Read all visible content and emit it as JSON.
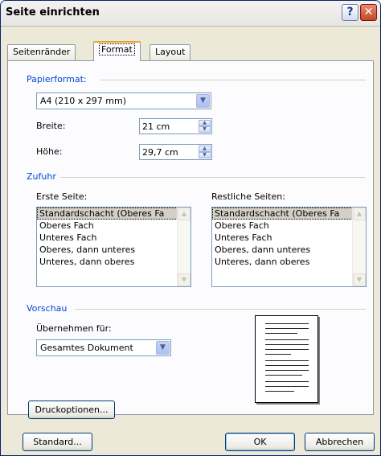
{
  "window": {
    "title": "Seite einrichten"
  },
  "titlebar": {
    "help_glyph": "?",
    "close_glyph": "✕"
  },
  "tabs": [
    {
      "label": "Seitenränder",
      "selected": false
    },
    {
      "label": "Format",
      "selected": true
    },
    {
      "label": "Layout",
      "selected": false
    }
  ],
  "papierformat": {
    "group_label": "Papierformat:",
    "size_value": "A4 (210 x 297 mm)",
    "width_label": "Breite:",
    "width_value": "21 cm",
    "height_label": "Höhe:",
    "height_value": "29,7 cm"
  },
  "zufuhr": {
    "group_label": "Zufuhr",
    "first_label": "Erste Seite:",
    "rest_label": "Restliche Seiten:",
    "first_items": [
      "Standardschacht (Oberes Fa",
      "Oberes Fach",
      "Unteres Fach",
      "Oberes, dann unteres",
      "Unteres, dann oberes"
    ],
    "rest_items": [
      "Standardschacht (Oberes Fa",
      "Oberes Fach",
      "Unteres Fach",
      "Oberes, dann unteres",
      "Unteres, dann oberes"
    ]
  },
  "vorschau": {
    "group_label": "Vorschau",
    "apply_label": "Übernehmen für:",
    "apply_value": "Gesamtes Dokument"
  },
  "buttons": {
    "druckoptionen": "Druckoptionen...",
    "standard": "Standard...",
    "ok": "OK",
    "abbrechen": "Abbrechen"
  },
  "icons": {
    "dropdown": "chevron-down-icon",
    "spin_up": "spin-up-icon",
    "spin_down": "spin-down-icon",
    "scroll_up": "scroll-up-icon",
    "scroll_down": "scroll-down-icon"
  },
  "colors": {
    "group_title": "#0046d5",
    "tab_highlight": "#f0a020",
    "close_button": "#c44726",
    "dialog_bg": "#ece9d8",
    "panel_bg": "#fcfcfe"
  }
}
